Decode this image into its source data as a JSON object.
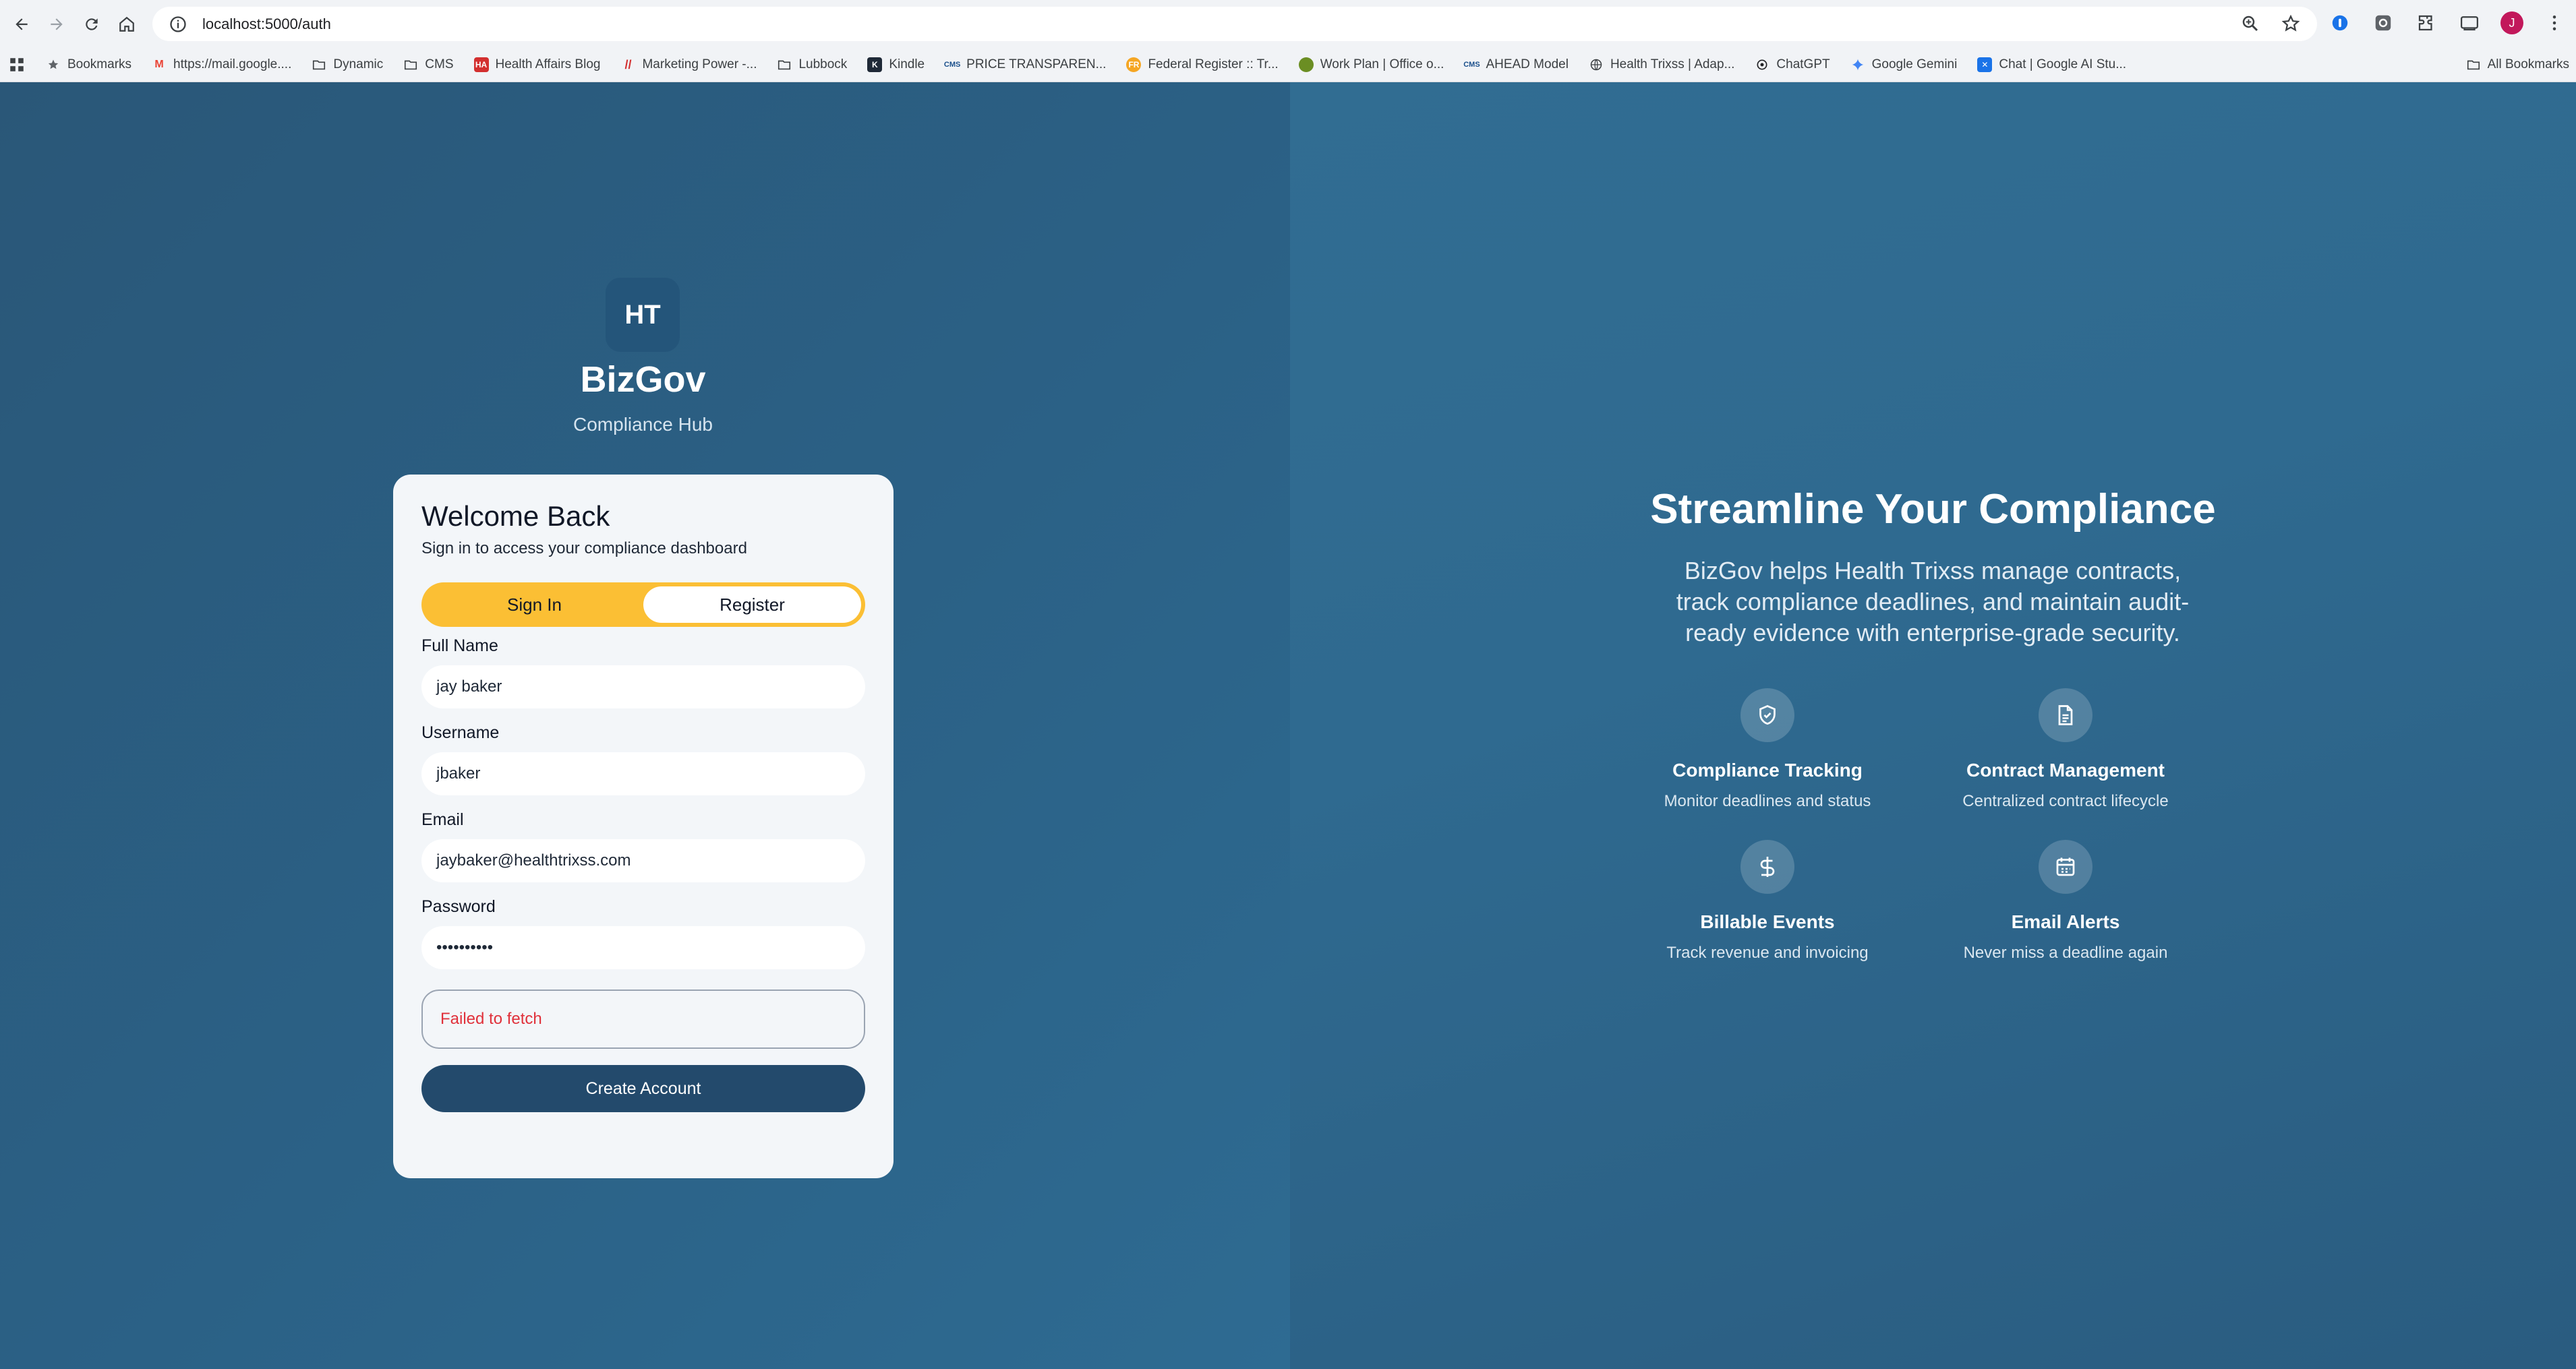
{
  "browser": {
    "url": "localhost:5000/auth",
    "avatar_letter": "J",
    "bookmarks": [
      {
        "label": "Bookmarks",
        "icon": "star-icon"
      },
      {
        "label": "https://mail.google....",
        "icon": "gmail-icon"
      },
      {
        "label": "Dynamic",
        "icon": "folder-icon"
      },
      {
        "label": "CMS",
        "icon": "folder-icon"
      },
      {
        "label": "Health Affairs Blog",
        "icon": "health-affairs-icon"
      },
      {
        "label": "Marketing Power -...",
        "icon": "marketing-icon"
      },
      {
        "label": "Lubbock",
        "icon": "folder-icon"
      },
      {
        "label": "Kindle",
        "icon": "kindle-icon"
      },
      {
        "label": "PRICE TRANSPAREN...",
        "icon": "cms-icon"
      },
      {
        "label": "Federal Register :: Tr...",
        "icon": "federal-register-icon"
      },
      {
        "label": "Work Plan | Office o...",
        "icon": "oig-icon"
      },
      {
        "label": "AHEAD Model",
        "icon": "cms-icon"
      },
      {
        "label": "Health Trixss | Adap...",
        "icon": "globe-icon"
      },
      {
        "label": "ChatGPT",
        "icon": "chatgpt-icon"
      },
      {
        "label": "Google Gemini",
        "icon": "gemini-icon"
      },
      {
        "label": "Chat | Google AI Stu...",
        "icon": "ai-studio-icon"
      }
    ],
    "all_bookmarks": "All Bookmarks"
  },
  "brand": {
    "logo_text": "HT",
    "name": "BizGov",
    "tagline": "Compliance Hub"
  },
  "auth": {
    "title": "Welcome Back",
    "subtitle": "Sign in to access your compliance dashboard",
    "tabs": {
      "sign_in": "Sign In",
      "register": "Register"
    },
    "fields": {
      "full_name": {
        "label": "Full Name",
        "value": "jay baker"
      },
      "username": {
        "label": "Username",
        "value": "jbaker"
      },
      "email": {
        "label": "Email",
        "value": "jaybaker@healthtrixss.com"
      },
      "password": {
        "label": "Password",
        "value": "••••••••••"
      }
    },
    "error": "Failed to fetch",
    "submit_label": "Create Account"
  },
  "hero": {
    "title": "Streamline Your Compliance",
    "description": "BizGov helps Health Trixss manage contracts, track compliance deadlines, and maintain audit-ready evidence with enterprise-grade security.",
    "features": [
      {
        "title": "Compliance Tracking",
        "desc": "Monitor deadlines and status",
        "icon": "shield-check-icon"
      },
      {
        "title": "Contract Management",
        "desc": "Centralized contract lifecycle",
        "icon": "document-icon"
      },
      {
        "title": "Billable Events",
        "desc": "Track revenue and invoicing",
        "icon": "dollar-icon"
      },
      {
        "title": "Email Alerts",
        "desc": "Never miss a deadline again",
        "icon": "calendar-icon"
      }
    ]
  },
  "colors": {
    "accent_yellow": "#fbbf34",
    "primary_button": "#234a6c",
    "error_red": "#e0313b"
  }
}
